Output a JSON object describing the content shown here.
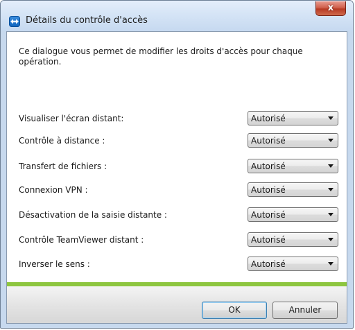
{
  "window": {
    "title": "Détails du contrôle d'accès",
    "close_glyph": "x"
  },
  "dialog": {
    "intro": "Ce dialogue vous permet de modifier les droits d'accès pour chaque opération.",
    "rows": [
      {
        "label": "Visualiser l'écran distant:",
        "value": "Autorisé"
      },
      {
        "label": "Contrôle à distance :",
        "value": "Autorisé"
      },
      {
        "label": "Transfert de fichiers :",
        "value": "Autorisé"
      },
      {
        "label": "Connexion VPN :",
        "value": "Autorisé"
      },
      {
        "label": "Désactivation de la saisie distante :",
        "value": "Autorisé"
      },
      {
        "label": "Contrôle TeamViewer distant :",
        "value": "Autorisé"
      },
      {
        "label": "Inverser le sens :",
        "value": "Autorisé"
      }
    ]
  },
  "buttons": {
    "ok": "OK",
    "cancel": "Annuler"
  },
  "icons": {
    "app": "teamviewer-icon",
    "close": "close-icon",
    "dropdown": "chevron-down-icon"
  },
  "colors": {
    "accent_bar": "#8dc63f",
    "titlebar": "#d5e4f6",
    "close_button": "#c7442d"
  }
}
